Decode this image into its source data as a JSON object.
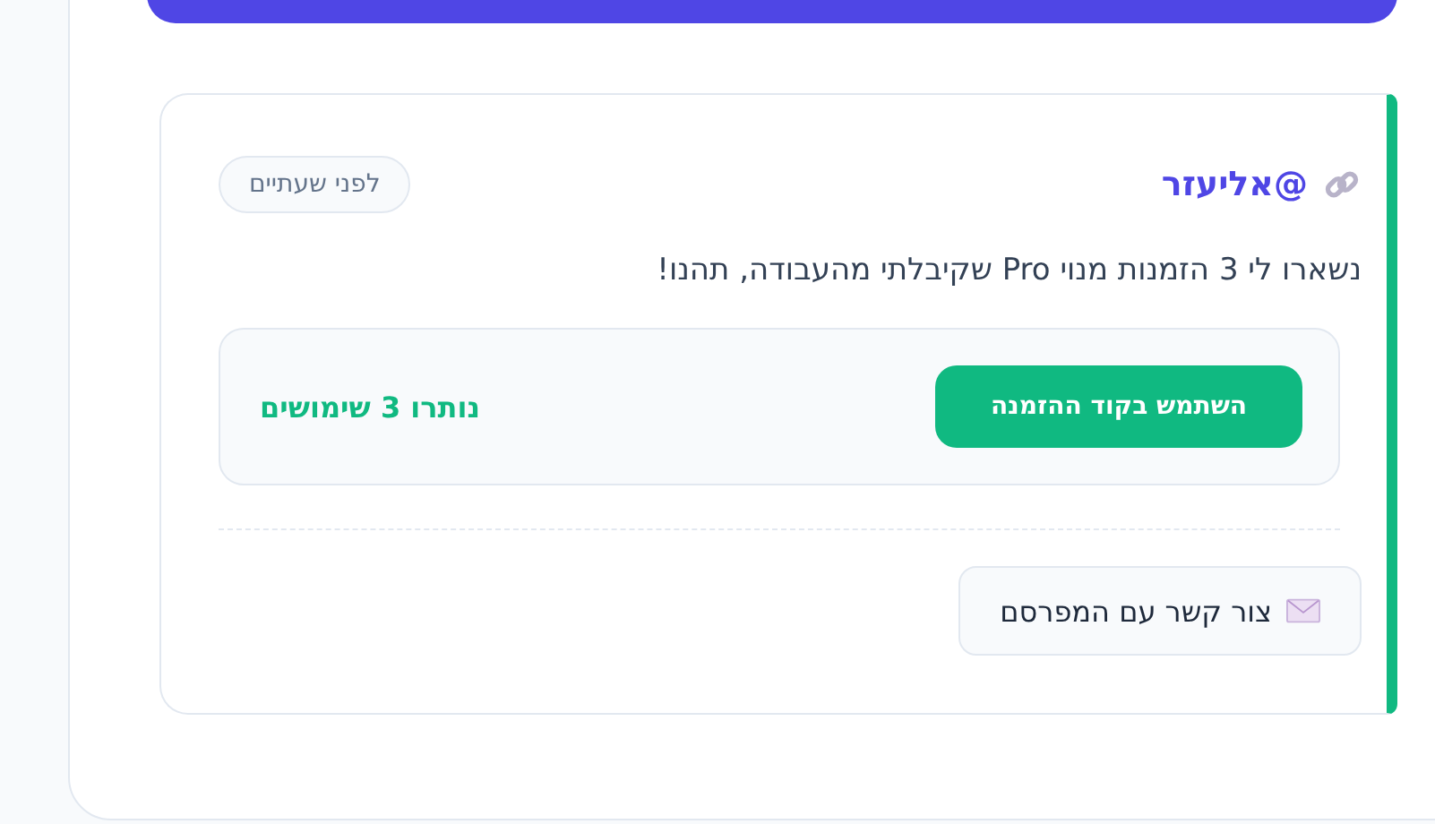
{
  "post": {
    "author": "@אליעזר",
    "timestamp": "לפני שעתיים",
    "message": "נשארו לי 3 הזמנות מנוי Pro שקיבלתי מהעבודה, תהנו!"
  },
  "invite": {
    "button": "השתמש בקוד ההזמנה",
    "remaining": "נותרו 3 שימושים"
  },
  "contact_button": "צור קשר עם המפרסם"
}
